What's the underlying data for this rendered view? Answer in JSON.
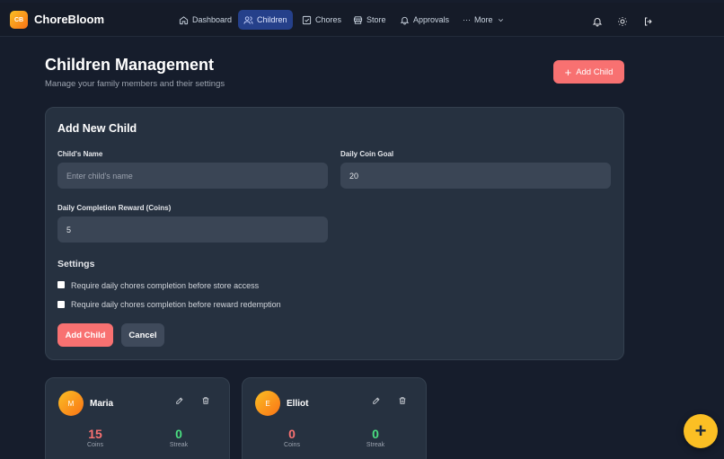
{
  "brand": {
    "logo_text": "CB",
    "name": "ChoreBloom"
  },
  "nav": {
    "dashboard": "Dashboard",
    "children": "Children",
    "chores": "Chores",
    "store": "Store",
    "approvals": "Approvals",
    "more": "More"
  },
  "header": {
    "title": "Children Management",
    "subtitle": "Manage your family members and their settings",
    "add_button": "Add Child"
  },
  "form": {
    "title": "Add New Child",
    "name_label": "Child's Name",
    "name_placeholder": "Enter child's name",
    "name_value": "",
    "goal_label": "Daily Coin Goal",
    "goal_value": "20",
    "reward_label": "Daily Completion Reward (Coins)",
    "reward_value": "5",
    "settings_heading": "Settings",
    "setting1": "Require daily chores completion before store access",
    "setting2": "Require daily chores completion before reward redemption",
    "submit": "Add Child",
    "cancel": "Cancel"
  },
  "children": [
    {
      "initial": "M",
      "name": "Maria",
      "coins": "15",
      "coins_label": "Coins",
      "streak": "0",
      "streak_label": "Streak"
    },
    {
      "initial": "E",
      "name": "Elliot",
      "coins": "0",
      "coins_label": "Coins",
      "streak": "0",
      "streak_label": "Streak"
    }
  ],
  "fab": "+"
}
